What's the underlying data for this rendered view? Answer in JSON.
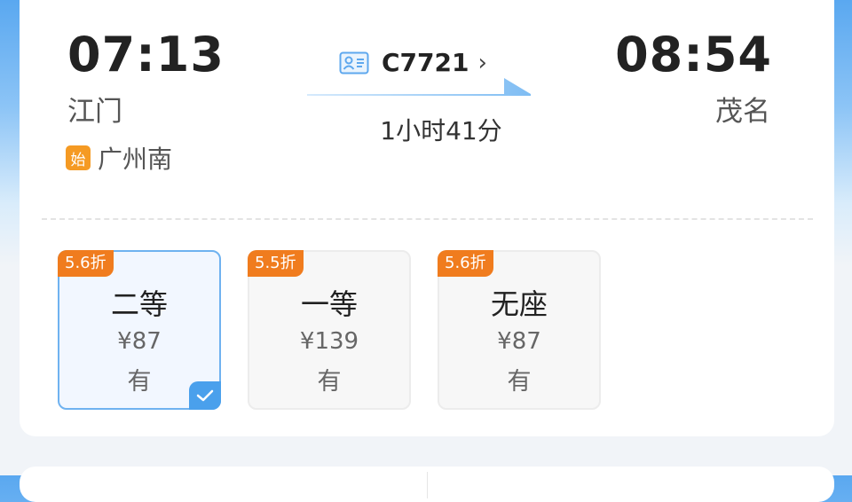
{
  "trip": {
    "depart_time": "07:13",
    "depart_station": "江门",
    "arrive_time": "08:54",
    "arrive_station": "茂名",
    "origin_badge": "始",
    "origin_station": "广州南",
    "train_no": "C7721",
    "duration": "1小时41分"
  },
  "seats": [
    {
      "discount": "5.6折",
      "class": "二等",
      "price": "¥87",
      "availability": "有",
      "selected": true
    },
    {
      "discount": "5.5折",
      "class": "一等",
      "price": "¥139",
      "availability": "有",
      "selected": false
    },
    {
      "discount": "5.6折",
      "class": "无座",
      "price": "¥87",
      "availability": "有",
      "selected": false
    }
  ],
  "colors": {
    "accent": "#4aa0ec",
    "discount_badge": "#f07c1e",
    "origin_badge": "#f59a23"
  },
  "icons": {
    "train_info": "ticket-card-icon",
    "train_link": "chevron-right-icon",
    "selected": "checkmark-icon"
  }
}
